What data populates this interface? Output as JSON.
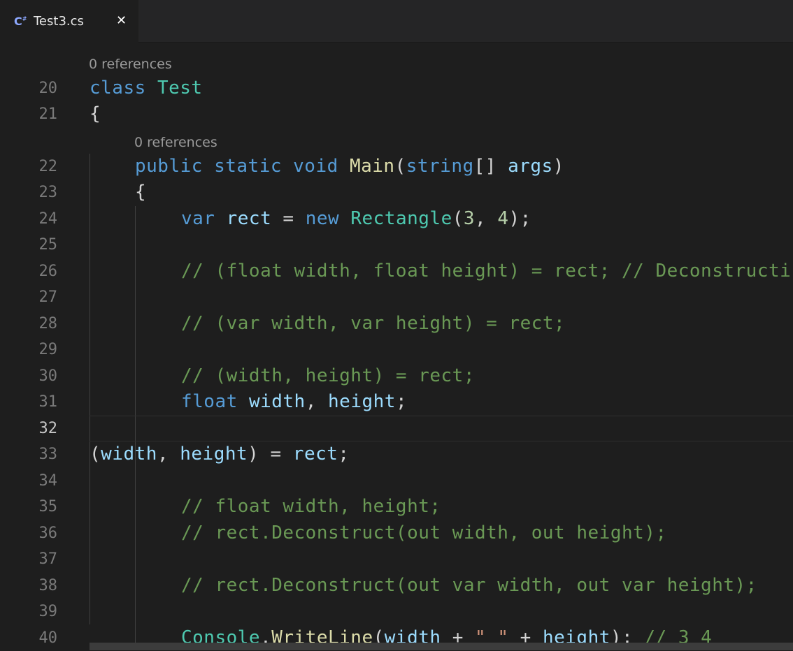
{
  "tab": {
    "icon": "csharp-file-icon",
    "label": "Test3.cs",
    "close": "✕"
  },
  "codelens": {
    "class_refs": "0 references",
    "method_refs": "0 references"
  },
  "lines": [
    {
      "number": "20",
      "tokens": [
        {
          "t": "class",
          "c": "kw"
        },
        {
          "t": " ",
          "c": ""
        },
        {
          "t": "Test",
          "c": "ty"
        }
      ]
    },
    {
      "number": "21",
      "tokens": [
        {
          "t": "{",
          "c": ""
        }
      ]
    },
    {
      "number": "22",
      "tokens": [
        {
          "t": "public",
          "c": "kw"
        },
        {
          "t": " ",
          "c": ""
        },
        {
          "t": "static",
          "c": "kw"
        },
        {
          "t": " ",
          "c": ""
        },
        {
          "t": "void",
          "c": "kw"
        },
        {
          "t": " ",
          "c": ""
        },
        {
          "t": "Main",
          "c": "fn"
        },
        {
          "t": "(",
          "c": ""
        },
        {
          "t": "string",
          "c": "kw"
        },
        {
          "t": "[] ",
          "c": ""
        },
        {
          "t": "args",
          "c": "var"
        },
        {
          "t": ")",
          "c": ""
        }
      ]
    },
    {
      "number": "23",
      "tokens": [
        {
          "t": "{",
          "c": ""
        }
      ]
    },
    {
      "number": "24",
      "tokens": [
        {
          "t": "var",
          "c": "kw"
        },
        {
          "t": " ",
          "c": ""
        },
        {
          "t": "rect",
          "c": "var"
        },
        {
          "t": " = ",
          "c": ""
        },
        {
          "t": "new",
          "c": "kw"
        },
        {
          "t": " ",
          "c": ""
        },
        {
          "t": "Rectangle",
          "c": "ty"
        },
        {
          "t": "(",
          "c": ""
        },
        {
          "t": "3",
          "c": "num"
        },
        {
          "t": ", ",
          "c": ""
        },
        {
          "t": "4",
          "c": "num"
        },
        {
          "t": ");",
          "c": ""
        }
      ]
    },
    {
      "number": "25",
      "tokens": []
    },
    {
      "number": "26",
      "tokens": [
        {
          "t": "// (float width, float height) = rect; // Deconstructi",
          "c": "cm"
        }
      ]
    },
    {
      "number": "27",
      "tokens": []
    },
    {
      "number": "28",
      "tokens": [
        {
          "t": "// (var width, var height) = rect;",
          "c": "cm"
        }
      ]
    },
    {
      "number": "29",
      "tokens": []
    },
    {
      "number": "30",
      "tokens": [
        {
          "t": "// (width, height) = rect;",
          "c": "cm"
        }
      ]
    },
    {
      "number": "31",
      "tokens": [
        {
          "t": "float",
          "c": "kw"
        },
        {
          "t": " ",
          "c": ""
        },
        {
          "t": "width",
          "c": "var"
        },
        {
          "t": ", ",
          "c": ""
        },
        {
          "t": "height",
          "c": "var"
        },
        {
          "t": ";",
          "c": ""
        }
      ]
    },
    {
      "number": "32",
      "tokens": []
    },
    {
      "number": "33",
      "tokens": [
        {
          "t": "(",
          "c": ""
        },
        {
          "t": "width",
          "c": "var"
        },
        {
          "t": ", ",
          "c": ""
        },
        {
          "t": "height",
          "c": "var"
        },
        {
          "t": ") = ",
          "c": ""
        },
        {
          "t": "rect",
          "c": "var"
        },
        {
          "t": ";",
          "c": ""
        }
      ]
    },
    {
      "number": "34",
      "tokens": []
    },
    {
      "number": "35",
      "tokens": [
        {
          "t": "// float width, height;",
          "c": "cm"
        }
      ]
    },
    {
      "number": "36",
      "tokens": [
        {
          "t": "// rect.Deconstruct(out width, out height);",
          "c": "cm"
        }
      ]
    },
    {
      "number": "37",
      "tokens": []
    },
    {
      "number": "38",
      "tokens": [
        {
          "t": "// rect.Deconstruct(out var width, out var height);",
          "c": "cm"
        }
      ]
    },
    {
      "number": "39",
      "tokens": []
    },
    {
      "number": "40",
      "tokens": [
        {
          "t": "Console",
          "c": "ty"
        },
        {
          "t": ".",
          "c": ""
        },
        {
          "t": "WriteLine",
          "c": "fn"
        },
        {
          "t": "(",
          "c": ""
        },
        {
          "t": "width",
          "c": "var"
        },
        {
          "t": " + ",
          "c": ""
        },
        {
          "t": "\" \"",
          "c": "str"
        },
        {
          "t": " + ",
          "c": ""
        },
        {
          "t": "height",
          "c": "var"
        },
        {
          "t": "); ",
          "c": ""
        },
        {
          "t": "// 3 4",
          "c": "cm"
        }
      ]
    }
  ],
  "active_line": "32",
  "colors": {
    "background": "#1e1e1e",
    "keyword": "#569cd6",
    "type": "#4ec9b0",
    "method": "#dcdcaa",
    "variable": "#9cdcfe",
    "number": "#b5cea8",
    "string": "#ce9178",
    "comment": "#6a9955"
  }
}
